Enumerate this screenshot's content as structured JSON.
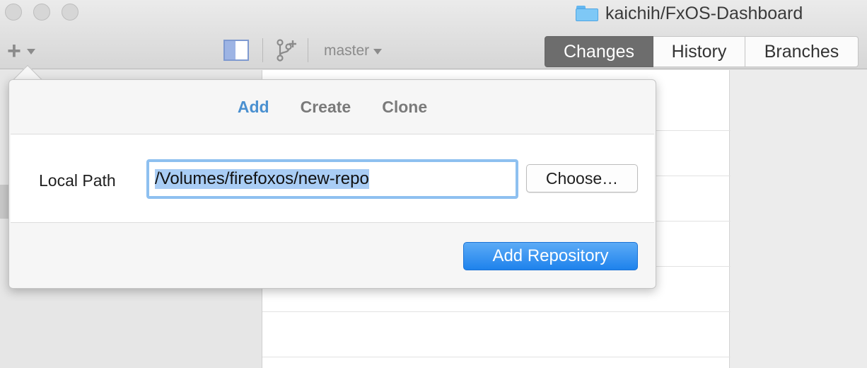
{
  "window": {
    "repo_title": "kaichih/FxOS-Dashboard"
  },
  "toolbar": {
    "branch": "master",
    "view_tabs": [
      "Changes",
      "History",
      "Branches"
    ],
    "active_tab": "Changes"
  },
  "popover": {
    "tabs": [
      "Add",
      "Create",
      "Clone"
    ],
    "active_tab": "Add",
    "local_path_label": "Local Path",
    "local_path_value": "/Volumes/firefoxos/new-repo",
    "choose_button": "Choose…",
    "submit_button": "Add Repository"
  },
  "colors": {
    "accent_blue": "#4a90d0",
    "submit_button": "#2b8cef",
    "active_segment": "#6d6d6d"
  }
}
